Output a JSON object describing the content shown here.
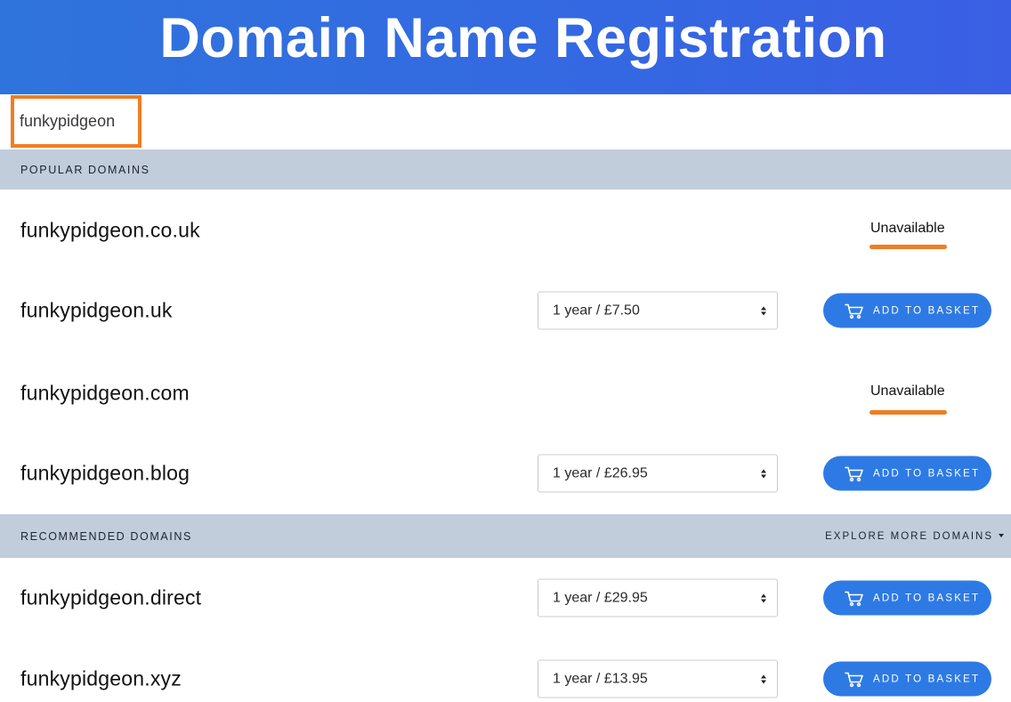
{
  "header": {
    "title": "Domain Name Registration"
  },
  "search": {
    "value": "funkypidgeon"
  },
  "sections": {
    "popular": {
      "title": "POPULAR DOMAINS"
    },
    "recommended": {
      "title": "RECOMMENDED DOMAINS",
      "explore_label": "EXPLORE MORE DOMAINS"
    }
  },
  "rows": [
    {
      "domain": "funkypidgeon.co.uk",
      "status": "Unavailable"
    },
    {
      "domain": "funkypidgeon.uk",
      "price_option": "1 year / £7.50",
      "button_label": "ADD TO BASKET"
    },
    {
      "domain": "funkypidgeon.com",
      "status": "Unavailable"
    },
    {
      "domain": "funkypidgeon.blog",
      "price_option": "1 year / £26.95",
      "button_label": "ADD TO BASKET"
    },
    {
      "domain": "funkypidgeon.direct",
      "price_option": "1 year / £29.95",
      "button_label": "ADD TO BASKET"
    },
    {
      "domain": "funkypidgeon.xyz",
      "price_option": "1 year / £13.95",
      "button_label": "ADD TO BASKET"
    }
  ],
  "icons": {
    "basket": "cart-icon",
    "select": "select-arrows-icon",
    "explore": "caret-down-icon"
  },
  "colors": {
    "banner": "#2f74dc",
    "accent_orange": "#f07d22",
    "button_blue": "#2e7ae4",
    "section_bar": "#c1cddb"
  }
}
